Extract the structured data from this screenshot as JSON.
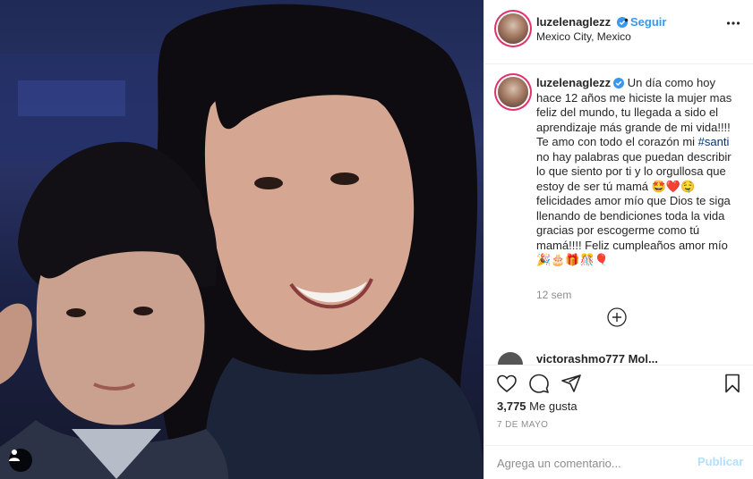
{
  "post_header": {
    "username": "luzelenaglezz",
    "follow_label": "Seguir",
    "separator": "•",
    "location": "Mexico City, Mexico",
    "more_icon": "ellipsis-icon"
  },
  "caption": {
    "username": "luzelenaglezz",
    "text_before_hashtag": "Un día como hoy hace 12 años me hiciste la mujer mas feliz del mundo, tu llegada a sido el aprendizaje más grande de mi vida!!!! Te amo con todo el corazón mi ",
    "hashtag": "#santi",
    "text_after_hashtag": " no hay palabras que puedan describir lo que siento por ti y lo orgullosa que estoy de ser tú mamá 🤩❤️🤤 felicidades amor mío que Dios te siga llenando de bendiciones toda la vida gracias por escogerme como tú mamá!!!! Feliz cumpleaños amor mío 🎉🎂🎁🎊🎈",
    "time_ago": "12 sem"
  },
  "next_comment_peek": {
    "username": "victorashmo777 Mol..."
  },
  "actions": {
    "like_icon": "heart-icon",
    "comment_icon": "comment-icon",
    "share_icon": "share-icon",
    "save_icon": "bookmark-icon",
    "likes_count": "3,775",
    "likes_label": "Me gusta",
    "date": "7 DE MAYO"
  },
  "add_comment": {
    "placeholder": "Agrega un comentario...",
    "publish_label": "Publicar"
  },
  "colors": {
    "link_blue": "#3897f0",
    "publish_disabled": "#b2dffc",
    "verified_badge": "#3897f0",
    "text_primary": "#262626",
    "text_secondary": "#8e8e8e"
  }
}
